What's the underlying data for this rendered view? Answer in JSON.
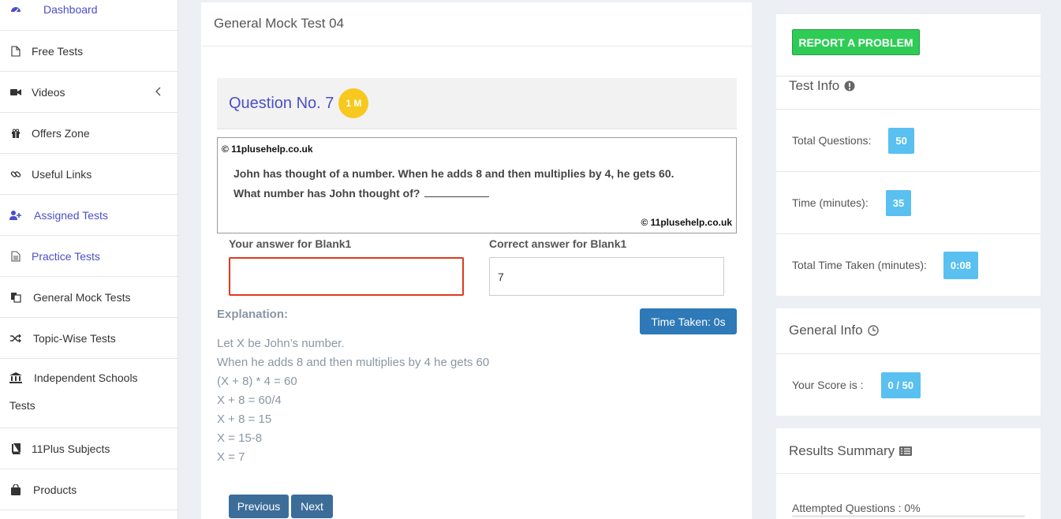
{
  "sidebar": {
    "items": [
      {
        "label": "Dashboard",
        "icon": "dashboard-icon",
        "active": true
      },
      {
        "label": "Free Tests",
        "icon": "file-icon"
      },
      {
        "label": "Videos",
        "icon": "video-icon"
      },
      {
        "label": "Offers Zone",
        "icon": "gift-icon"
      },
      {
        "label": "Useful Links",
        "icon": "link-icon"
      },
      {
        "label": "Assigned Tests",
        "icon": "user-plus-icon",
        "active": true
      },
      {
        "label": "Practice Tests",
        "icon": "document-icon",
        "active": true
      },
      {
        "label": "General Mock Tests",
        "icon": "copy-icon"
      },
      {
        "label": "Topic-Wise Tests",
        "icon": "shuffle-icon"
      },
      {
        "label": "Independent Schools",
        "label_cont": "Tests",
        "icon": "institution-icon"
      },
      {
        "label": "11Plus Subjects",
        "icon": "book-icon"
      },
      {
        "label": "Products",
        "icon": "shopping-bag-icon"
      }
    ]
  },
  "main": {
    "title": "General Mock Test 04",
    "question_title": "Question No. 7",
    "marks": "1 M",
    "copyright": "© 11plusehelp.co.uk",
    "question_line1": "John has thought of a number. When he adds 8 and then multiplies by 4, he gets 60.",
    "question_line2": "What number has John thought of?",
    "your_answer_label": "Your answer for Blank1",
    "your_answer_value": "",
    "correct_answer_label": "Correct answer for Blank1",
    "correct_answer_value": "7",
    "explanation_label": "Explanation:",
    "time_taken": "Time Taken: 0s",
    "explanation": [
      "Let X be John’s number.",
      "When he adds 8 and then multiplies by 4 he gets 60",
      "(X + 8) * 4 = 60",
      "X + 8 = 60/4",
      "X + 8 = 15",
      "X = 15-8",
      "X = 7"
    ],
    "previous_label": "Previous",
    "next_label": "Next"
  },
  "right": {
    "report_label": "REPORT A PROBLEM",
    "test_info_title": "Test Info",
    "total_questions_label": "Total Questions:",
    "total_questions": "50",
    "time_label": "Time (minutes):",
    "time": "35",
    "time_taken_label": "Total Time Taken (minutes):",
    "time_taken": "0:08",
    "general_info_title": "General Info",
    "score_label": "Your Score is :",
    "score": "0 / 50",
    "results_title": "Results Summary",
    "attempted_label": "Attempted Questions : 0%",
    "attempted_fraction": 0
  },
  "colors": {
    "accent": "#4b4fc8",
    "report": "#2ecc55",
    "badge": "#59c0f0",
    "time_button": "#2e79b7",
    "wrong": "#e0391c"
  }
}
